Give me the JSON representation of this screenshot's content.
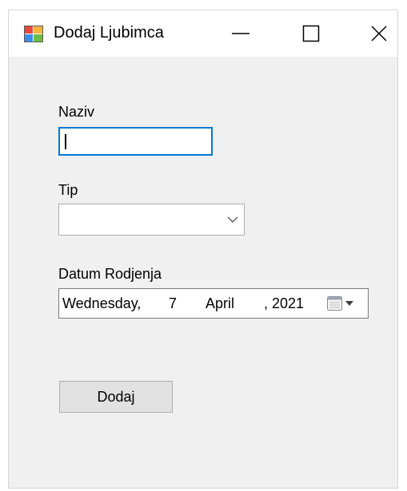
{
  "window": {
    "title": "Dodaj Ljubimca"
  },
  "form": {
    "naziv_label": "Naziv",
    "naziv_value": "",
    "tip_label": "Tip",
    "tip_value": "",
    "datum_label": "Datum Rodjenja",
    "datum": {
      "weekday": "Wednesday,",
      "day": "7",
      "month": "April",
      "year": ", 2021"
    },
    "submit_label": "Dodaj"
  },
  "icons": {
    "app": "app-form-icon",
    "minimize": "minimize-icon",
    "maximize": "maximize-icon",
    "close": "close-icon",
    "dropdown": "chevron-down-icon",
    "calendar": "calendar-icon"
  },
  "colors": {
    "focus_border": "#0078d7",
    "window_bg": "#f0f0f0",
    "button_bg": "#e1e1e1"
  }
}
